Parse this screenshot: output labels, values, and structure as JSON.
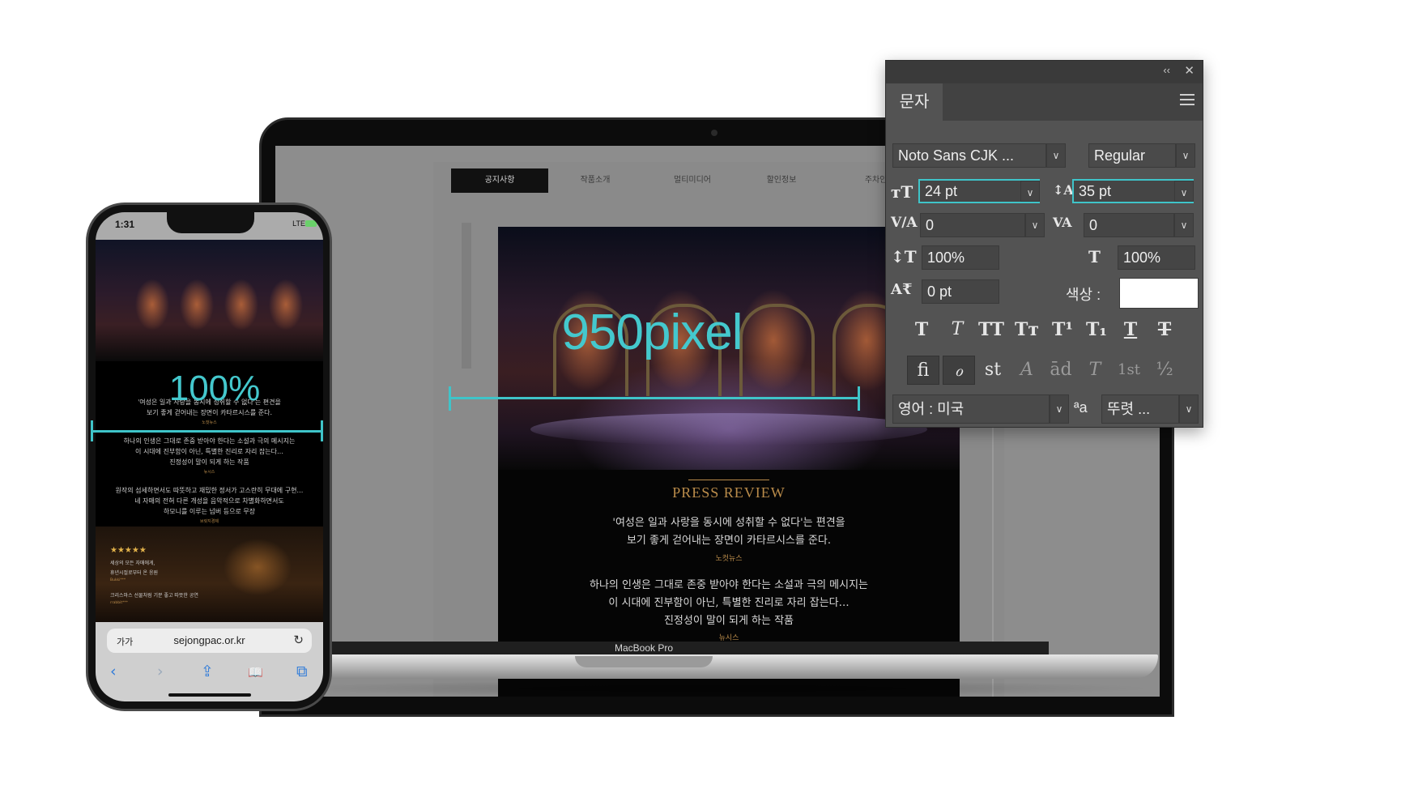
{
  "laptop": {
    "brand": "MacBook Pro",
    "nav_tabs": [
      {
        "label": "공지사항",
        "active": true
      },
      {
        "label": "작품소개",
        "active": false
      },
      {
        "label": "멀티미디어",
        "active": false
      },
      {
        "label": "할인정보",
        "active": false
      },
      {
        "label": "주차안내/입장안내/취소·환불",
        "active": false
      }
    ],
    "press": {
      "title": "PRESS REVIEW",
      "quote1_line1": "'여성은 일과 사랑을 동시에 성취할 수 없다'는 편견을",
      "quote1_line2": "보기 좋게 걷어내는 장면이 카타르시스를 준다.",
      "source1": "노컷뉴스",
      "quote2_line1": "하나의 인생은 그대로 존중 받아야 한다는 소설과 극의 메시지는",
      "quote2_line2": "이 시대에 진부함이 아닌, 특별한 진리로 자리 잡는다…",
      "quote2_line3": "진정성이 말이 되게 하는 작품",
      "source2": "뉴시스"
    },
    "measure_label": "950pixel"
  },
  "phone": {
    "time": "1:31",
    "signal": "LTE",
    "measure_label": "100%",
    "texts": [
      "'여성은 일과 사랑을 동시에 성취할 수 없다'는 편견을",
      "보기 좋게 걷어내는 장면이 카타르시스를 준다.",
      "하나의 인생은 그대로 존중 받아야 한다는 소설과 극의 메시지는",
      "이 시대에 진부함이 아닌, 특별한 진리로 자리 잡는다…",
      "진정성이 말이 되게 하는 작품",
      "원작의 섬세하면서도 따뜻하고 재밌한 정서가 고스란히 무대에 구현…",
      "네 자매의 전혀 다른 개성을 음악적으로 차별화하면서도",
      "하모니를 이루는 넘버 등으로 무장"
    ],
    "sources": [
      "노컷뉴스",
      "뉴시스",
      "브릿지경제"
    ],
    "stars": "★★★★★",
    "review_lines": [
      "세상의 모든 자매에게,",
      "휴년시절로부터 온 응원",
      "크리스마스 선물처럼 기분 좋고 따뜻한 공연"
    ],
    "review_sources": [
      "Bukki***",
      "rrabbit***"
    ],
    "url_aa": "가가",
    "url": "sejongpac.or.kr",
    "reload_icon": "↻",
    "toolbar_icons": [
      "‹",
      "›",
      "⇪",
      "📖",
      "⧉"
    ]
  },
  "panel": {
    "title": "문자",
    "collapse_icon": "‹‹",
    "close_icon": "✕",
    "font_family": "Noto Sans CJK ...",
    "font_style": "Regular",
    "font_size": "24 pt",
    "leading": "35 pt",
    "kerning": "0",
    "tracking": "0",
    "vertical_scale": "100%",
    "horizontal_scale": "100%",
    "baseline_shift": "0 pt",
    "color_label": "색상 :",
    "color_value": "#ffffff",
    "language": "영어 : 미국",
    "aa_label": "ªa",
    "antialias": "뚜렷 ...",
    "style_buttons": [
      "T",
      "T",
      "TT",
      "Tт",
      "T¹",
      "T₁",
      "T",
      "T"
    ],
    "opentype_buttons": [
      "fi",
      "ℴ",
      "st",
      "A",
      "ād",
      "T",
      "1st",
      "½"
    ]
  }
}
